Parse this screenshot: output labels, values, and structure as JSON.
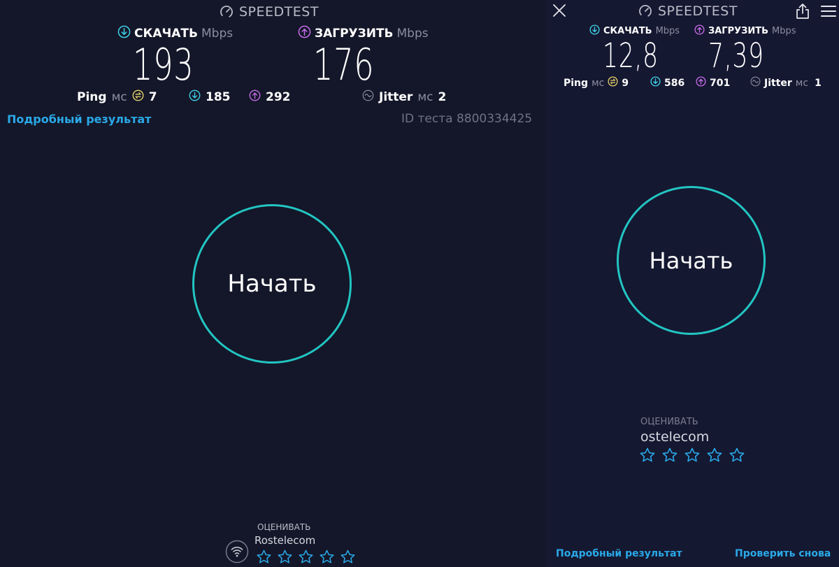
{
  "colors": {
    "background": "#141729",
    "accent_cyan": "#22c5c2",
    "download": "#3fd0e6",
    "upload": "#c46be8",
    "ping": "#e9d36a",
    "link": "#2aa9e8"
  },
  "left": {
    "brand": "SPEEDTEST",
    "download": {
      "label": "СКАЧАТЬ",
      "unit": "Mbps",
      "value": "193"
    },
    "upload": {
      "label": "ЗАГРУЗИТЬ",
      "unit": "Mbps",
      "value": "176"
    },
    "ping": {
      "label": "Ping",
      "unit": "мс",
      "value": "7"
    },
    "ping_down": "185",
    "ping_up": "292",
    "jitter": {
      "label": "Jitter",
      "unit": "мс",
      "value": "2"
    },
    "details_link": "Подробный результат",
    "test_id": "ID теста 8800334425",
    "start_button": "Начать",
    "rate": {
      "label": "ОЦЕНИВАТЬ",
      "provider": "Rostelecom",
      "stars": 5
    }
  },
  "right": {
    "brand": "SPEEDTEST",
    "close_icon": "close-icon",
    "share_icon": "share-icon",
    "menu_icon": "menu-icon",
    "download": {
      "label": "СКАЧАТЬ",
      "unit": "Mbps",
      "value": "12,8"
    },
    "upload": {
      "label": "ЗАГРУЗИТЬ",
      "unit": "Mbps",
      "value": "7,39"
    },
    "ping": {
      "label": "Ping",
      "unit": "мс",
      "value": "9"
    },
    "ping_down": "586",
    "ping_up": "701",
    "jitter": {
      "label": "Jitter",
      "unit": "мс",
      "value": "1"
    },
    "start_button": "Начать",
    "rate": {
      "label": "ОЦЕНИВАТЬ",
      "provider": "ostelecom",
      "stars": 5
    },
    "details_link": "Подробный результат",
    "retest_link": "Проверить снова"
  }
}
